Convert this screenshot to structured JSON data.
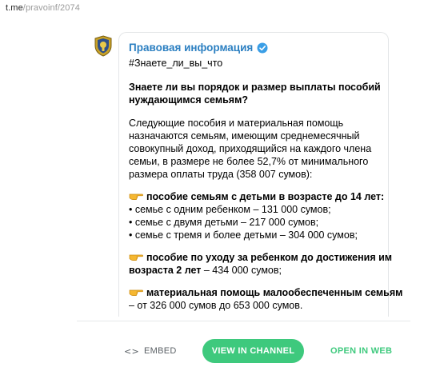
{
  "url": {
    "host": "t.me",
    "path": "/pravoinf/2074"
  },
  "post": {
    "channel_name": "Правовая информация",
    "hashtag": "#Знаете_ли_вы_что",
    "heading_lines": [
      "Знаете ли вы порядок и размер выплаты пособий",
      "нуждающимся семьям?"
    ],
    "intro_lines": [
      "Следующие пособия и материальная помощь",
      "назначаются семьям, имеющим среднемесячный",
      "совокупный доход, приходящийся на каждого члена",
      "семьи, в размере не более 52,7% от минимального",
      "размера оплаты труда (358 007 сумов):"
    ],
    "section1": {
      "title": "пособие семьям с детьми в возрасте до 14 лет:",
      "items": [
        "• семье с одним ребенком – 131 000 сумов;",
        "• семье с двумя детьми – 217 000 сумов;",
        "• семье с тремя и более детьми – 304 000 сумов;"
      ]
    },
    "section2": {
      "title_line1": "пособие по уходу за ребенком до достижения им",
      "title_line2": "возраста 2 лет",
      "title_rest": " – 434 000 сумов;"
    },
    "section3": {
      "title": "материальная помощь малообеспеченным семьям",
      "line2": "– от 326 000 сумов до 653 000 сумов."
    }
  },
  "actions": {
    "embed_label": "EMBED",
    "view_label": "VIEW IN CHANNEL",
    "open_label": "OPEN IN WEB"
  },
  "colors": {
    "channel_blue": "#2b7fc1",
    "accent_green": "#3ec97d",
    "verified_blue": "#3a9ee6"
  },
  "icons": {
    "verified": "verified-badge-icon",
    "hand": "pointing-hand-icon",
    "embed": "code-brackets-icon",
    "avatar": "channel-logo-emblem"
  }
}
